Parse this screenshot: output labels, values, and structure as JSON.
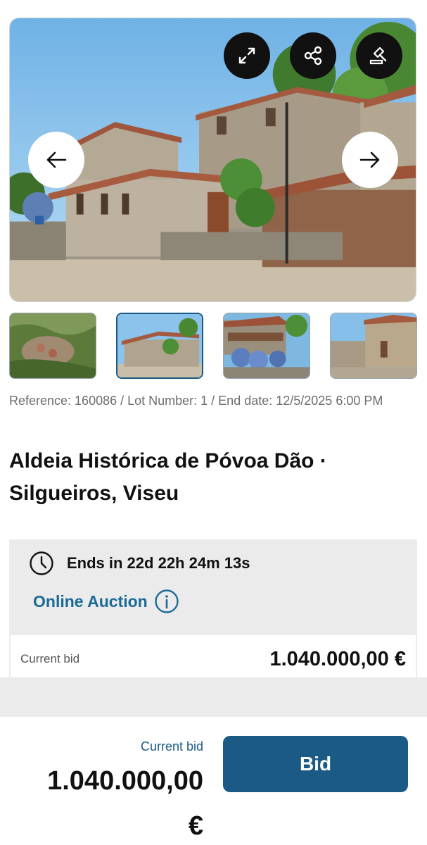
{
  "gallery": {
    "thumbnails": [
      "thumb-1",
      "thumb-2",
      "thumb-3",
      "thumb-4"
    ],
    "active_index": 1
  },
  "listing": {
    "reference": "Reference: 160086 / Lot Number: 1 / End date: 12/5/2025 6:00 PM",
    "title": "Aldeia Histórica de Póvoa Dão · Silgueiros, Viseu"
  },
  "auction": {
    "ends_in": "Ends in 22d 22h 24m 13s",
    "type_link": "Online Auction",
    "current_bid_label": "Current bid",
    "current_bid_value": "1.040.000,00 €"
  },
  "bottom_bar": {
    "label": "Current bid",
    "amount": "1.040.000,00",
    "currency": "€",
    "bid_button": "Bid"
  },
  "colors": {
    "brand_blue": "#1c5a86",
    "link_blue": "#1c6b96",
    "card_bg": "#ebebeb"
  },
  "icons": [
    "fullscreen-icon",
    "share-icon",
    "auction-gavel-icon",
    "arrow-left-icon",
    "arrow-right-icon",
    "clock-icon",
    "info-icon"
  ]
}
